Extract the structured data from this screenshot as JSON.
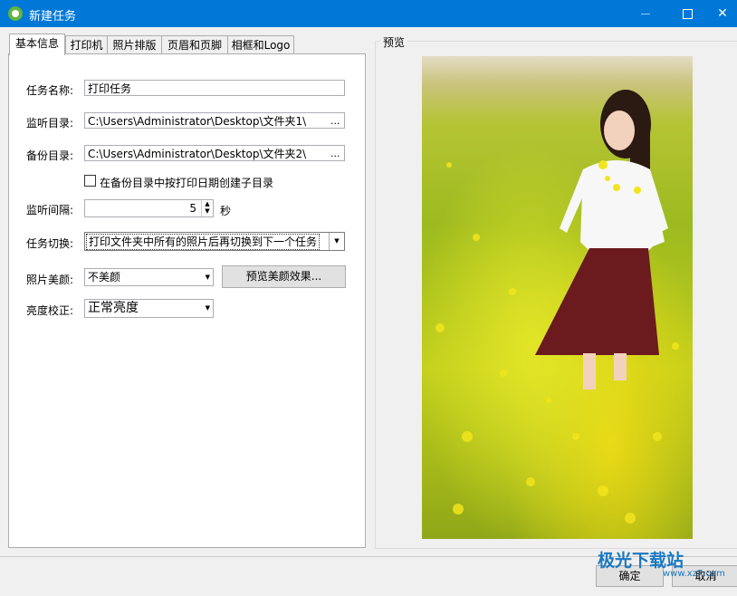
{
  "window": {
    "title": "新建任务"
  },
  "tabs": [
    "基本信息",
    "打印机",
    "照片排版",
    "页眉和页脚",
    "相框和Logo"
  ],
  "form": {
    "task_name_label": "任务名称:",
    "task_name_value": "打印任务",
    "watch_dir_label": "监听目录:",
    "watch_dir_value": "C:\\Users\\Administrator\\Desktop\\文件夹1\\",
    "backup_dir_label": "备份目录:",
    "backup_dir_value": "C:\\Users\\Administrator\\Desktop\\文件夹2\\",
    "browse_label": "...",
    "subdir_checkbox_label": "在备份目录中按打印日期创建子目录",
    "subdir_checked": false,
    "interval_label": "监听间隔:",
    "interval_value": "5",
    "interval_unit": "秒",
    "switch_label": "任务切换:",
    "switch_value": "打印文件夹中所有的照片后再切换到下一个任务",
    "beauty_label": "照片美颜:",
    "beauty_value": "不美颜",
    "beauty_preview_button": "预览美颜效果...",
    "brightness_label": "亮度校正:",
    "brightness_value": "正常亮度"
  },
  "preview": {
    "title": "预览"
  },
  "footer": {
    "ok_label": "确定",
    "cancel_label": "取消"
  },
  "watermark": {
    "text": "极光下载站",
    "url": "www.xz7.com"
  },
  "colors": {
    "titlebar": "#0078d7",
    "app_icon": "#62b53f"
  }
}
